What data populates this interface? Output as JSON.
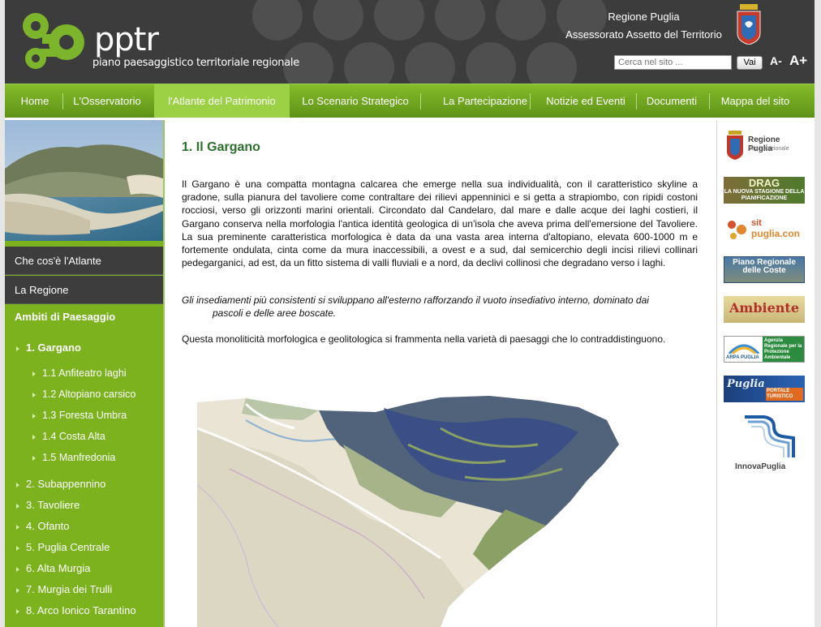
{
  "header": {
    "logo_title": "pptr",
    "logo_subtitle": "piano paesaggistico territoriale regionale",
    "region_name": "Regione Puglia",
    "region_office": "Assessorato Assetto del Territorio",
    "search_placeholder": "Cerca nel sito ...",
    "search_button": "Vai",
    "font_small": "A-",
    "font_large": "A+"
  },
  "nav": {
    "items": [
      "Home",
      "L'Osservatorio",
      "l'Atlante del Patrimonio",
      "Lo Scenario Strategico",
      "La Partecipazione",
      "Notizie ed Eventi",
      "Documenti",
      "Mappa del sito"
    ],
    "active": "l'Atlante del Patrimonio"
  },
  "sidebar": {
    "item_what": "Che cos'è l'Atlante",
    "item_region": "La Regione",
    "heading": "Ambiti di Paesaggio",
    "current": "1. Gargano",
    "subitems": [
      "1.1 Anfiteatro laghi",
      "1.2 Altopiano carsico",
      "1.3 Foresta Umbra",
      "1.4 Costa Alta",
      "1.5 Manfredonia"
    ],
    "items": [
      "2. Subappennino",
      "3. Tavoliere",
      "4. Ofanto",
      "5. Puglia Centrale",
      "6. Alta Murgia",
      "7. Murgia dei Trulli",
      "8. Arco Ionico Tarantino"
    ]
  },
  "main": {
    "title": "1. Il Gargano",
    "p1": "Il Gargano è una compatta montagna calcarea che emerge nella sua individualità, con il caratteristico skyline a gradone, sulla pianura del tavoliere come contraltare dei rilievi appenninici e si getta a strapiombo, con ripidi costoni rocciosi, verso gli orizzonti marini orientali. Circondato dal Candelaro, dal mare e dalle acque dei laghi costieri, il Gargano conserva nella morfologia l'antica identità geologica di un'isola che aveva prima dell'emersione del Tavoliere. La sua preminente caratteristica morfologica è data da una vasta area interna d'altopiano, elevata 600-1000 m e fortemente ondulata, cinta come da mura inaccessibili, a ovest e a sud, dal semicerchio degli incisi rilievi collinari pedegarganici, ad est, da un fitto sistema di valli fluviali e a nord, da declivi collinosi che degradano verso i laghi.",
    "p2_line1": "Gli insediamenti più consistenti si sviluppano all'esterno rafforzando il vuoto insediativo interno,  dominato dai",
    "p2_line2": "pascoli e delle aree boscate.",
    "p3": "Questa monoliticità morfologica e geolitologica si frammenta nella varietà di paesaggi che lo contraddistinguono."
  },
  "right": {
    "regione_title": "Regione Puglia",
    "regione_sub": "Sito istituzionale",
    "drag_title": "DRAG",
    "drag_sub": "LA NUOVA STAGIONE DELLA PIANIFICAZIONE",
    "sit_1": "sit",
    "sit_2": "puglia.con",
    "coste": "Piano Regionale delle Coste",
    "ambiente": "Ambiente",
    "arpa_left": "ARPA PUGLIA",
    "arpa_right": "Agenzia Regionale per la Protezione Ambientale",
    "turismo_1": "Puglia",
    "turismo_2": "PORTALE TURISTICO",
    "innova": "InnovaPuglia"
  }
}
